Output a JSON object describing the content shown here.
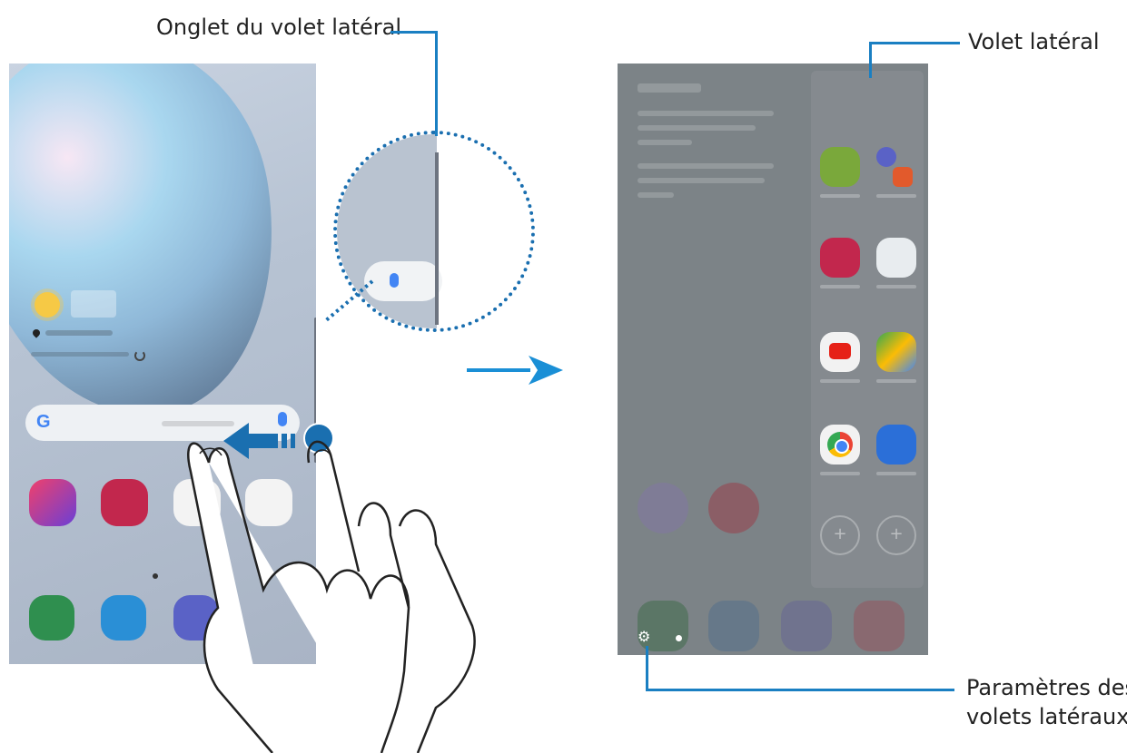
{
  "callouts": {
    "edge_handle": "Onglet du volet latéral",
    "edge_panel": "Volet latéral",
    "settings_line1": "Paramètres des",
    "settings_line2": "volets latéraux"
  },
  "colors": {
    "callout_line": "#1a7fc2",
    "arrow": "#1a8fd6",
    "swipe_arrow": "#1a6fb0"
  },
  "icons": {
    "search_logo": "G",
    "gear": "⚙",
    "add": "+"
  }
}
